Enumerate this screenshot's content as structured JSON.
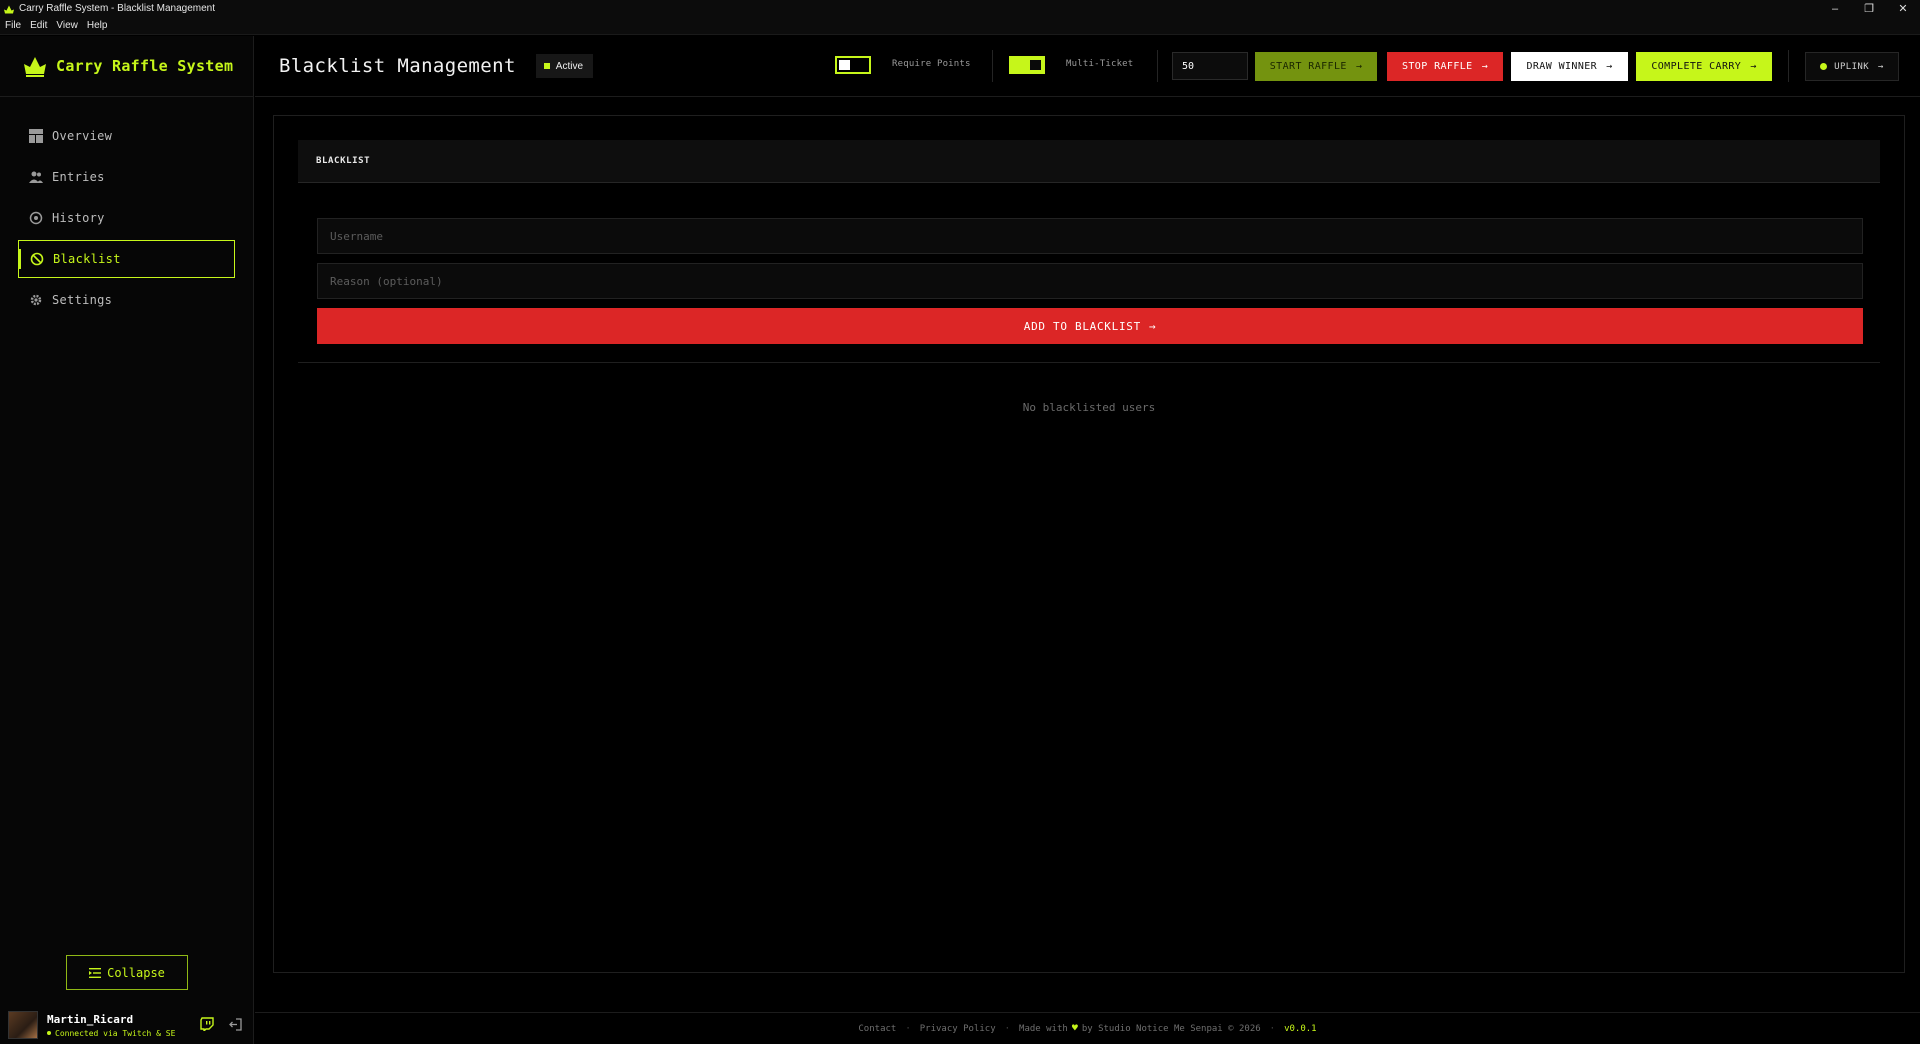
{
  "window": {
    "title": "Carry Raffle System - Blacklist Management",
    "menu": [
      "File",
      "Edit",
      "View",
      "Help"
    ],
    "controls": {
      "minimize": "–",
      "maximize": "❐",
      "close": "✕"
    }
  },
  "brand": {
    "name": "Carry Raffle System"
  },
  "sidebar": {
    "items": [
      {
        "label": "Overview",
        "icon": "dashboard-icon"
      },
      {
        "label": "Entries",
        "icon": "users-icon"
      },
      {
        "label": "History",
        "icon": "history-icon"
      },
      {
        "label": "Blacklist",
        "icon": "ban-icon",
        "active": true
      },
      {
        "label": "Settings",
        "icon": "gear-icon"
      }
    ],
    "collapse_label": "Collapse",
    "user": {
      "name": "Martin_Ricard",
      "status": "Connected via Twitch & SE"
    }
  },
  "header": {
    "title": "Blacklist Management",
    "badge": "Active",
    "toggles": [
      {
        "label": "Require Points",
        "on": false
      },
      {
        "label": "Multi-Ticket",
        "on": true
      }
    ],
    "ticket_value": "50",
    "buttons": {
      "start": "START RAFFLE",
      "stop": "STOP RAFFLE",
      "draw": "DRAW WINNER",
      "complete": "COMPLETE CARRY",
      "uplink": "UPLINK"
    },
    "arrow": "→"
  },
  "blacklist": {
    "heading": "BLACKLIST",
    "username_placeholder": "Username",
    "reason_placeholder": "Reason (optional)",
    "add_label": "ADD TO BLACKLIST",
    "empty_text": "No blacklisted users"
  },
  "footer": {
    "contact": "Contact",
    "privacy": "Privacy Policy",
    "made_with": "Made with",
    "by": "by Studio Notice Me Senpai © 2026",
    "version": "v0.0.1",
    "dot": "·"
  },
  "colors": {
    "accent": "#c6f61a",
    "danger": "#dc2626",
    "background": "#000000"
  }
}
